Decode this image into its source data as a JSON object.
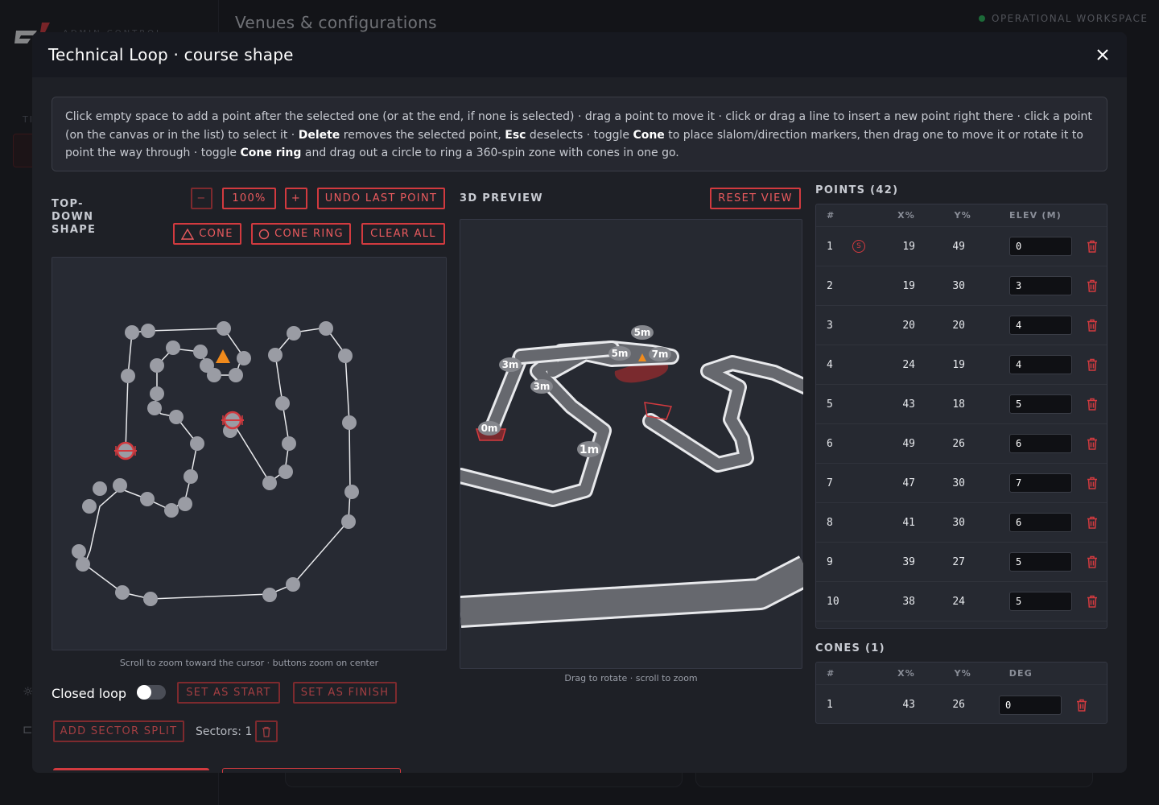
{
  "background": {
    "brand": "ADMIN CONTROL",
    "section_initial": "TI",
    "page_title": "Venues & configurations",
    "workspace_status": "OPERATIONAL WORKSPACE"
  },
  "modal": {
    "title": "Technical Loop · course shape",
    "close_icon": "close-icon",
    "instructions": {
      "p1": "Click empty space to add a point after the selected one (or at the end, if none is selected) · drag a point to move it · click or drag a line to insert a new point right there · click a point (on the canvas or in the list) to select it · ",
      "b1": "Delete",
      "p2": " removes the selected point, ",
      "b2": "Esc",
      "p3": " deselects · toggle ",
      "b3": "Cone",
      "p4": " to place slalom/direction markers, then drag one to move it or rotate it to point the way through · toggle ",
      "b4": "Cone ring",
      "p5": " and drag out a circle to ring a 360-spin zone with cones in one go."
    },
    "topdown": {
      "label": "TOP-DOWN SHAPE",
      "zoom_out": "−",
      "zoom_level": "100%",
      "zoom_in": "+",
      "undo": "UNDO LAST POINT",
      "cone": "CONE",
      "cone_ring": "CONE RING",
      "clear_all": "CLEAR ALL",
      "hint": "Scroll to zoom toward the cursor · buttons zoom on center"
    },
    "preview": {
      "label": "3D PREVIEW",
      "reset_view": "RESET VIEW",
      "hint": "Drag to rotate · scroll to zoom",
      "elevation_labels": [
        "5m",
        "5m",
        "7m",
        "3m",
        "3m",
        "0m",
        "1m"
      ]
    },
    "controls": {
      "closed_loop": "Closed loop",
      "closed_loop_on": false,
      "set_start": "SET AS START",
      "set_finish": "SET AS FINISH",
      "add_sector": "ADD SECTOR SPLIT",
      "sectors": "Sectors: 1"
    },
    "points": {
      "title": "POINTS (42)",
      "headers": [
        "#",
        "X%",
        "Y%",
        "ELEV (M)"
      ],
      "start_badge": "S",
      "rows": [
        {
          "n": "1",
          "x": "19",
          "y": "49",
          "elev": "0"
        },
        {
          "n": "2",
          "x": "19",
          "y": "30",
          "elev": "3"
        },
        {
          "n": "3",
          "x": "20",
          "y": "20",
          "elev": "4"
        },
        {
          "n": "4",
          "x": "24",
          "y": "19",
          "elev": "4"
        },
        {
          "n": "5",
          "x": "43",
          "y": "18",
          "elev": "5"
        },
        {
          "n": "6",
          "x": "49",
          "y": "26",
          "elev": "6"
        },
        {
          "n": "7",
          "x": "47",
          "y": "30",
          "elev": "7"
        },
        {
          "n": "8",
          "x": "41",
          "y": "30",
          "elev": "6"
        },
        {
          "n": "9",
          "x": "39",
          "y": "27",
          "elev": "5"
        },
        {
          "n": "10",
          "x": "38",
          "y": "24",
          "elev": "5"
        }
      ]
    },
    "cones": {
      "title": "CONES (1)",
      "headers": [
        "#",
        "X%",
        "Y%",
        "DEG"
      ],
      "rows": [
        {
          "n": "1",
          "x": "43",
          "y": "26",
          "deg": "0"
        }
      ]
    },
    "colors": {
      "accent": "#d23a3f",
      "point": "#9a9ca4",
      "cone": "#f08a1c",
      "track": "#6a6c72"
    }
  }
}
